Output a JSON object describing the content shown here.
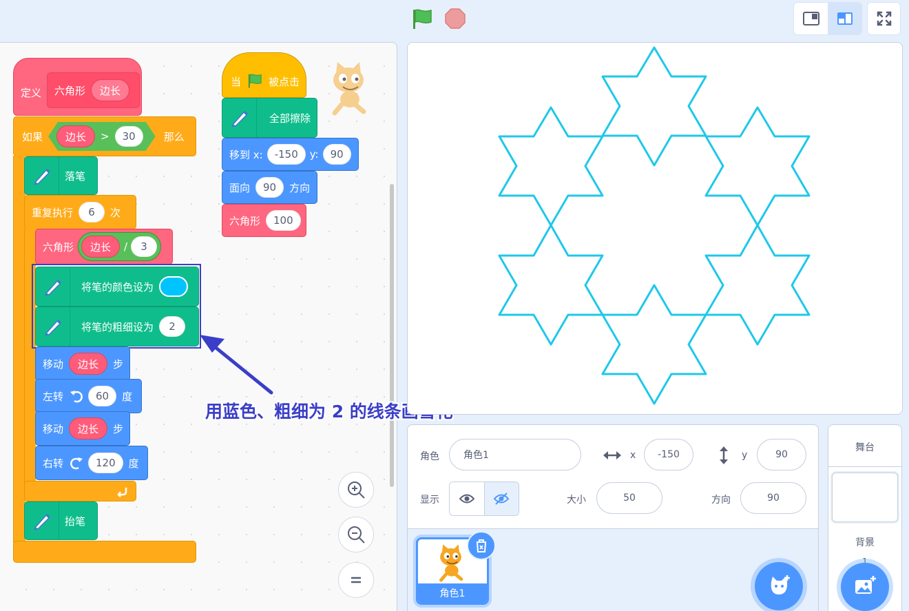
{
  "controls": {
    "green_flag_icon": "green-flag-icon",
    "stop_icon": "stop-icon"
  },
  "code": {
    "define_block": {
      "label": "定义",
      "name": "六角形",
      "param": "边长"
    },
    "if_block": {
      "label": "如果",
      "param": "边长",
      "op": ">",
      "value": "30",
      "then": "那么"
    },
    "pen_down": "落笔",
    "repeat_block": {
      "label": "重复执行",
      "times": "6",
      "unit": "次"
    },
    "hexagon_call": {
      "label": "六角形",
      "param": "边长",
      "op": "/",
      "value": "3"
    },
    "set_color": {
      "label": "将笔的颜色设为",
      "color": "#00c4ff"
    },
    "set_size": {
      "label": "将笔的粗细设为",
      "value": "2"
    },
    "move1": {
      "label": "移动",
      "param": "边长",
      "unit": "步"
    },
    "turn_left": {
      "label": "左转",
      "value": "60",
      "unit": "度"
    },
    "move2": {
      "label": "移动",
      "param": "边长",
      "unit": "步"
    },
    "turn_right": {
      "label": "右转",
      "value": "120",
      "unit": "度"
    },
    "pen_up": "抬笔",
    "when_flag": {
      "label_when": "当",
      "label_clicked": "被点击"
    },
    "clear_all": "全部擦除",
    "goto": {
      "label": "移到 x:",
      "x": "-150",
      "label_y": "y:",
      "y": "90"
    },
    "point_dir": {
      "label": "面向",
      "value": "90",
      "unit": "方向"
    },
    "hex_main": {
      "label": "六角形",
      "value": "100"
    }
  },
  "annotation": "用蓝色、粗细为 2 的线条画雪花",
  "sprite_info": {
    "sprite_label": "角色",
    "sprite_name": "角色1",
    "x_label": "x",
    "x_value": "-150",
    "y_label": "y",
    "y_value": "90",
    "show_label": "显示",
    "size_label": "大小",
    "size_value": "50",
    "direction_label": "方向",
    "direction_value": "90"
  },
  "sprite_list": [
    {
      "name": "角色1"
    }
  ],
  "stage_pane": {
    "title": "舞台",
    "backdrop_label": "背景",
    "backdrop_count": "1"
  },
  "colors": {
    "pen_color": "#1ec8ea",
    "accent": "#4c97ff"
  }
}
